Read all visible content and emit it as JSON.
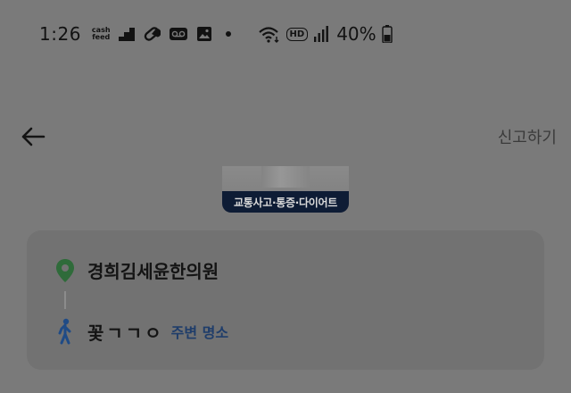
{
  "status_bar": {
    "time": "1:26",
    "cashfeed_line1": "cash",
    "cashfeed_line2": "feed",
    "hd_badge": "HD",
    "battery": "40%"
  },
  "header": {
    "back_icon": "arrow-left-icon",
    "report_label": "신고하기"
  },
  "thumbnail": {
    "caption": "교통사고·통증·다이어트"
  },
  "route": {
    "origin_icon": "map-pin-icon",
    "origin_name": "경희김세윤한의원",
    "origin_icon_color": "#2f6b3a",
    "destination_icon": "walking-person-icon",
    "destination_name": "꽃ㄱㄱㅇ",
    "destination_icon_color": "#1f4b86",
    "nearby_label": "주변 명소",
    "nearby_color": "#1f3d6a"
  }
}
